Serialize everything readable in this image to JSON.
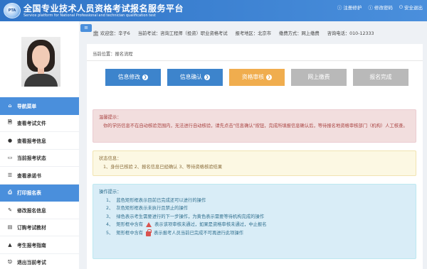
{
  "header": {
    "logo_text": "PTA",
    "title_cn": "全国专业技术人员资格考试报名服务平台",
    "title_en": "Service platform for National Professional and technician qualification test",
    "links": [
      {
        "icon": "info-circle-icon",
        "glyph": "ⓘ",
        "label": "注册修护"
      },
      {
        "icon": "info-circle-icon",
        "glyph": "ⓘ",
        "label": "修改密码"
      },
      {
        "icon": "power-icon",
        "glyph": "⏻",
        "label": "安全退出"
      }
    ]
  },
  "infobar": {
    "welcome": "欢迎您：辛子6",
    "exam": "当前考试：咨询工程师（投资）职业资格考试",
    "region": "报考地区：北京市",
    "payment": "缴费方式：网上缴费",
    "phone": "咨询电话：010-12333"
  },
  "sidebar": {
    "menu_toggle": "≡",
    "items": [
      {
        "label": "导航菜单",
        "glyph": "⌂",
        "icon": "home-icon",
        "active": true
      },
      {
        "label": "查看考试文件",
        "glyph": "🗎",
        "icon": "file-icon",
        "active": false
      },
      {
        "label": "查看报考信息",
        "glyph": "●",
        "icon": "user-circle-icon",
        "active": false
      },
      {
        "label": "当前报考状态",
        "glyph": "▭",
        "icon": "monitor-icon",
        "active": false
      },
      {
        "label": "查看承诺书",
        "glyph": "☰",
        "icon": "list-icon",
        "active": false
      },
      {
        "label": "打印报名表",
        "glyph": "⎙",
        "icon": "print-icon",
        "active": true
      },
      {
        "label": "修改报名信息",
        "glyph": "✎",
        "icon": "edit-icon",
        "active": false
      },
      {
        "label": "订购考试教材",
        "glyph": "▤",
        "icon": "book-icon",
        "active": false
      },
      {
        "label": "考生报考指南",
        "glyph": "▲",
        "icon": "guide-icon",
        "active": false
      },
      {
        "label": "退出当前考试",
        "glyph": "⎋",
        "icon": "exit-icon",
        "active": false
      }
    ]
  },
  "main": {
    "breadcrumb": "当前位置：报名流程",
    "steps": [
      {
        "label": "信息修改",
        "state": "done"
      },
      {
        "label": "信息确认",
        "state": "done"
      },
      {
        "label": "资格审核",
        "state": "cur"
      },
      {
        "label": "网上缴费",
        "state": "todo"
      },
      {
        "label": "报名完成",
        "state": "todo"
      }
    ],
    "step_arrow": "❯",
    "warning": {
      "title": "温馨提示：",
      "text": "你的学历信息不在自动核验范围内，无法进行自动核验，请先点击\"信息确认\"按钮，完成所填报信息确认后，等待报名地资格审核部门（机构）人工核查。"
    },
    "status": {
      "title": "状态信息：",
      "text": "1、身份已核验 2、报名信息已经确认 3、等待资格核验结果"
    },
    "instructions": {
      "title": "操作提示：",
      "items": [
        {
          "num": "1、",
          "before": "蓝色矩形框表示目前已完成还可以进行的操作",
          "symbol": "",
          "after": ""
        },
        {
          "num": "2、",
          "before": "灰色矩形框表示未执行且禁止的操作",
          "symbol": "",
          "after": ""
        },
        {
          "num": "3、",
          "before": "绿色表示考生需要进行的下一步操作，为黄色表示需要等待机构完成的操作",
          "symbol": "",
          "after": ""
        },
        {
          "num": "4、",
          "before": "矩形框中含有",
          "symbol": "warning-triangle-icon",
          "after": "表示该项审核未通过，如果是资格审核未通过，中止报名"
        },
        {
          "num": "5、",
          "before": "矩形框中含有",
          "symbol": "lock-icon",
          "after": "表示报考人员当前已完成不可再进行此项操作"
        }
      ]
    }
  }
}
